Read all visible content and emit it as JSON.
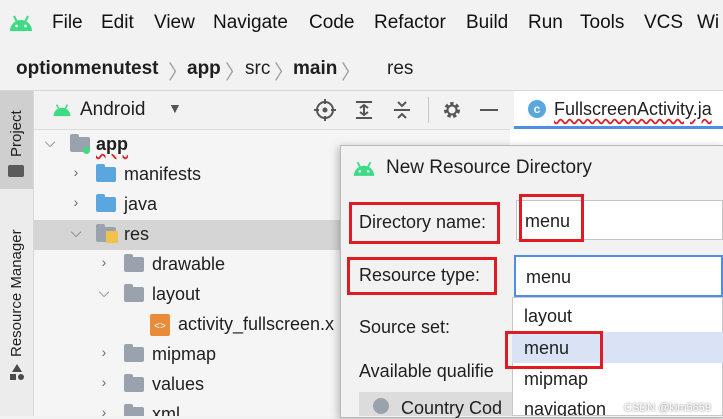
{
  "colors": {
    "android_green": "#3ddc84",
    "folder_blue": "#5aa7e0",
    "folder_gray": "#9aa3ad",
    "highlight_red": "#e01b24",
    "focus_blue": "#4d8ee8"
  },
  "menubar": {
    "items": [
      {
        "label": "File",
        "icon": "android-icon"
      },
      {
        "label": "Edit"
      },
      {
        "label": "View"
      },
      {
        "label": "Navigate"
      },
      {
        "label": "Code"
      },
      {
        "label": "Refactor"
      },
      {
        "label": "Build"
      },
      {
        "label": "Run"
      },
      {
        "label": "Tools"
      },
      {
        "label": "VCS"
      },
      {
        "label": "Wi"
      }
    ]
  },
  "breadcrumb": {
    "items": [
      "optionmenutest",
      "app",
      "src",
      "main",
      "res"
    ]
  },
  "toolstrip": {
    "project_tab": "Project",
    "resource_manager_tab": "Resource Manager"
  },
  "project_panel": {
    "view_selector": "Android",
    "tree": [
      {
        "label": "app",
        "level": 0,
        "expanded": true,
        "bold": true,
        "icon": "module-folder-icon"
      },
      {
        "label": "manifests",
        "level": 1,
        "expanded": false,
        "icon": "blue-folder-icon"
      },
      {
        "label": "java",
        "level": 1,
        "expanded": false,
        "icon": "blue-folder-icon"
      },
      {
        "label": "res",
        "level": 1,
        "expanded": true,
        "selected": true,
        "icon": "res-folder-icon"
      },
      {
        "label": "drawable",
        "level": 2,
        "expanded": false,
        "icon": "gray-folder-icon"
      },
      {
        "label": "layout",
        "level": 2,
        "expanded": true,
        "icon": "gray-folder-icon"
      },
      {
        "label": "activity_fullscreen.x",
        "level": 3,
        "icon": "layout-file-icon"
      },
      {
        "label": "mipmap",
        "level": 2,
        "expanded": false,
        "icon": "gray-folder-icon"
      },
      {
        "label": "values",
        "level": 2,
        "expanded": false,
        "icon": "gray-folder-icon"
      },
      {
        "label": "xml",
        "level": 2,
        "expanded": false,
        "icon": "gray-folder-icon"
      }
    ]
  },
  "editor": {
    "tab_label": "FullscreenActivity.ja",
    "tab_icon": "class-c-icon"
  },
  "dialog": {
    "title": "New Resource Directory",
    "directory_name_label": "Directory name:",
    "directory_name_value": "menu",
    "resource_type_label": "Resource type:",
    "resource_type_value": "menu",
    "source_set_label": "Source set:",
    "available_qualifiers_label": "Available qualifie",
    "qualifier_first": "Country Cod",
    "dropdown_options": [
      "layout",
      "menu",
      "mipmap",
      "navigation"
    ],
    "dropdown_selected": "menu"
  },
  "watermark": "CSDN @kim5659"
}
